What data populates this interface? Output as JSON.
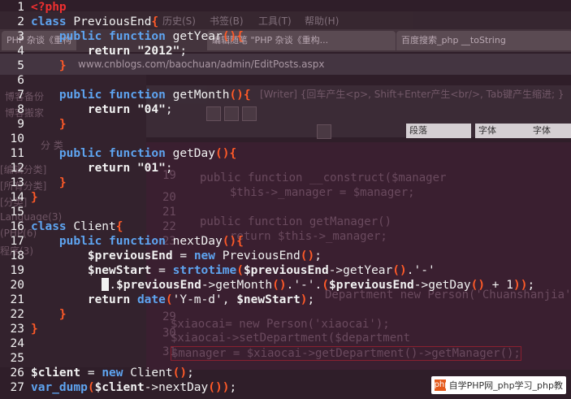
{
  "background": {
    "menu_items": [
      "历史(S)",
      "书签(B)",
      "工具(T)",
      "帮助(H)"
    ],
    "tabs": [
      "PHP 杂谈《重构",
      "编辑随笔 \"PHP 杂谈《重构...",
      "百度搜索_php __toString"
    ],
    "url": "www.cnblogs.com/baochuan/admin/EditPosts.aspx",
    "sidebar_items": [
      "博客备份",
      "博客搬家",
      "分 类",
      "[编辑分类]",
      "[所有分类]",
      "[分类]",
      "Language(3)",
      "(PHP(6)",
      "程序(3)"
    ],
    "editor_hint": "[Writer] {回车产生<p>, Shift+Enter产生<br/>, Tab键产生缩进; }",
    "toolbar_select_1": "段落",
    "toolbar_select_2": "字体",
    "toolbar_select_3": "字体",
    "ghost_code": [
      "public function __construct($manager",
      "$this->_manager = $manager;",
      "public function getManager()",
      "return $this->_manager;",
      "Department new Person('Chuanshanjia'",
      "$xiaocai= new Person('xiaocai');",
      "$xiaocai->setDepartment($department",
      "$manager = $xiaocai->getDepartment()->getManager();"
    ],
    "ghost_numbers": [
      "19",
      "20",
      "21",
      "22",
      "23",
      "24",
      "25",
      "26",
      "27",
      "28",
      "29",
      "30",
      "31"
    ]
  },
  "code": {
    "lines": [
      {
        "n": "1",
        "tokens": [
          {
            "c": "ph",
            "t": "<?php"
          }
        ]
      },
      {
        "n": "2",
        "tokens": [
          {
            "c": "kw",
            "t": "class "
          },
          {
            "c": "plain",
            "t": "PreviousEnd"
          },
          {
            "c": "br",
            "t": "{"
          }
        ]
      },
      {
        "n": "3",
        "tokens": [
          {
            "c": "plain",
            "t": "    "
          },
          {
            "c": "kw",
            "t": "public function "
          },
          {
            "c": "plain",
            "t": "getYear"
          },
          {
            "c": "br",
            "t": "(){"
          }
        ]
      },
      {
        "n": "4",
        "tokens": [
          {
            "c": "plain",
            "t": "        "
          },
          {
            "c": "str",
            "t": "return "
          },
          {
            "c": "str",
            "t": "\"2012\""
          },
          {
            "c": "plain",
            "t": ";"
          }
        ]
      },
      {
        "n": "5",
        "tokens": [
          {
            "c": "plain",
            "t": "    "
          },
          {
            "c": "br",
            "t": "}"
          }
        ]
      },
      {
        "n": "6",
        "tokens": []
      },
      {
        "n": "7",
        "tokens": [
          {
            "c": "plain",
            "t": "    "
          },
          {
            "c": "kw",
            "t": "public function "
          },
          {
            "c": "plain",
            "t": "getMonth"
          },
          {
            "c": "br",
            "t": "(){"
          }
        ]
      },
      {
        "n": "8",
        "tokens": [
          {
            "c": "plain",
            "t": "        "
          },
          {
            "c": "str",
            "t": "return "
          },
          {
            "c": "str",
            "t": "\"04\""
          },
          {
            "c": "plain",
            "t": ";"
          }
        ]
      },
      {
        "n": "9",
        "tokens": [
          {
            "c": "plain",
            "t": "    "
          },
          {
            "c": "br",
            "t": "}"
          }
        ]
      },
      {
        "n": "10",
        "tokens": []
      },
      {
        "n": "11",
        "tokens": [
          {
            "c": "plain",
            "t": "    "
          },
          {
            "c": "kw",
            "t": "public function "
          },
          {
            "c": "plain",
            "t": "getDay"
          },
          {
            "c": "br",
            "t": "(){"
          }
        ]
      },
      {
        "n": "12",
        "tokens": [
          {
            "c": "plain",
            "t": "        "
          },
          {
            "c": "str",
            "t": "return "
          },
          {
            "c": "str",
            "t": "\"01\""
          },
          {
            "c": "plain",
            "t": ";"
          }
        ]
      },
      {
        "n": "13",
        "tokens": [
          {
            "c": "plain",
            "t": "    "
          },
          {
            "c": "br",
            "t": "}"
          }
        ]
      },
      {
        "n": "14",
        "tokens": [
          {
            "c": "br",
            "t": "}"
          }
        ]
      },
      {
        "n": "15",
        "tokens": []
      },
      {
        "n": "16",
        "tokens": [
          {
            "c": "kw",
            "t": "class "
          },
          {
            "c": "plain",
            "t": "Client"
          },
          {
            "c": "br",
            "t": "{"
          }
        ]
      },
      {
        "n": "17",
        "tokens": [
          {
            "c": "plain",
            "t": "    "
          },
          {
            "c": "kw",
            "t": "public function "
          },
          {
            "c": "plain",
            "t": "nextDay"
          },
          {
            "c": "br",
            "t": "(){"
          }
        ]
      },
      {
        "n": "18",
        "tokens": [
          {
            "c": "plain",
            "t": "        "
          },
          {
            "c": "var",
            "t": "$previousEnd"
          },
          {
            "c": "plain",
            "t": " = "
          },
          {
            "c": "kw",
            "t": "new "
          },
          {
            "c": "plain",
            "t": "PreviousEnd"
          },
          {
            "c": "br",
            "t": "()"
          },
          {
            "c": "plain",
            "t": ";"
          }
        ]
      },
      {
        "n": "19",
        "tokens": [
          {
            "c": "plain",
            "t": "        "
          },
          {
            "c": "var",
            "t": "$newStart"
          },
          {
            "c": "plain",
            "t": " = "
          },
          {
            "c": "kw",
            "t": "strtotime"
          },
          {
            "c": "br",
            "t": "("
          },
          {
            "c": "var",
            "t": "$previousEnd"
          },
          {
            "c": "plain",
            "t": "->getYear"
          },
          {
            "c": "br",
            "t": "()"
          },
          {
            "c": "plain",
            "t": ".'-'"
          }
        ]
      },
      {
        "n": "20",
        "tokens": [
          {
            "c": "plain",
            "t": "          "
          },
          {
            "c": "cursor",
            "t": ""
          },
          {
            "c": "plain",
            "t": "."
          },
          {
            "c": "var",
            "t": "$previousEnd"
          },
          {
            "c": "plain",
            "t": "->getMonth"
          },
          {
            "c": "br",
            "t": "()"
          },
          {
            "c": "plain",
            "t": ".'-'."
          },
          {
            "c": "br",
            "t": "("
          },
          {
            "c": "var",
            "t": "$previousEnd"
          },
          {
            "c": "plain",
            "t": "->getDay"
          },
          {
            "c": "br",
            "t": "()"
          },
          {
            "c": "plain",
            "t": " + 1"
          },
          {
            "c": "br",
            "t": "))"
          },
          {
            "c": "plain",
            "t": ";"
          }
        ]
      },
      {
        "n": "21",
        "tokens": [
          {
            "c": "plain",
            "t": "        "
          },
          {
            "c": "str",
            "t": "return "
          },
          {
            "c": "kw",
            "t": "date"
          },
          {
            "c": "br",
            "t": "("
          },
          {
            "c": "plain",
            "t": "'Y-m-d', "
          },
          {
            "c": "var",
            "t": "$newStart"
          },
          {
            "c": "br",
            "t": ")"
          },
          {
            "c": "plain",
            "t": ";"
          }
        ]
      },
      {
        "n": "22",
        "tokens": [
          {
            "c": "plain",
            "t": "    "
          },
          {
            "c": "br",
            "t": "}"
          }
        ]
      },
      {
        "n": "23",
        "tokens": [
          {
            "c": "br",
            "t": "}"
          }
        ]
      },
      {
        "n": "24",
        "tokens": []
      },
      {
        "n": "25",
        "tokens": []
      },
      {
        "n": "26",
        "tokens": [
          {
            "c": "var",
            "t": "$client"
          },
          {
            "c": "plain",
            "t": " = "
          },
          {
            "c": "kw",
            "t": "new "
          },
          {
            "c": "plain",
            "t": "Client"
          },
          {
            "c": "br",
            "t": "()"
          },
          {
            "c": "plain",
            "t": ";"
          }
        ]
      },
      {
        "n": "27",
        "tokens": [
          {
            "c": "kw",
            "t": "var_dump"
          },
          {
            "c": "br",
            "t": "("
          },
          {
            "c": "var",
            "t": "$client"
          },
          {
            "c": "plain",
            "t": "->nextDay"
          },
          {
            "c": "br",
            "t": "())"
          },
          {
            "c": "plain",
            "t": ";"
          }
        ]
      }
    ]
  },
  "watermark": {
    "logo": "php",
    "text": "自学PHP网_php学习_php教"
  }
}
